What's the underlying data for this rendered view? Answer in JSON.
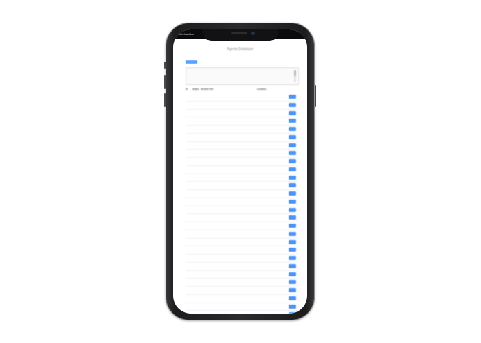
{
  "status_bar": {
    "left": "Job Machine",
    "right": ""
  },
  "page": {
    "title": "Agents Database",
    "add_button": ""
  },
  "search": {
    "lines": [
      "",
      "",
      "",
      ""
    ]
  },
  "table": {
    "headers": [
      "ID",
      "Status",
      "Number",
      "Title",
      "",
      "Location"
    ],
    "rows": [
      {
        "id": "",
        "status": "",
        "num": "",
        "name": "",
        "loc": ""
      },
      {
        "id": "",
        "status": "",
        "num": "",
        "name": "",
        "loc": ""
      },
      {
        "id": "",
        "status": "",
        "num": "",
        "name": "",
        "loc": ""
      },
      {
        "id": "",
        "status": "",
        "num": "",
        "name": "",
        "loc": ""
      },
      {
        "id": "",
        "status": "",
        "num": "",
        "name": "",
        "loc": ""
      },
      {
        "id": "",
        "status": "",
        "num": "",
        "name": "",
        "loc": ""
      },
      {
        "id": "",
        "status": "",
        "num": "",
        "name": "",
        "loc": ""
      },
      {
        "id": "",
        "status": "",
        "num": "",
        "name": "",
        "loc": ""
      },
      {
        "id": "",
        "status": "",
        "num": "",
        "name": "",
        "loc": ""
      },
      {
        "id": "",
        "status": "",
        "num": "",
        "name": "",
        "loc": ""
      },
      {
        "id": "",
        "status": "",
        "num": "",
        "name": "",
        "loc": ""
      },
      {
        "id": "",
        "status": "",
        "num": "",
        "name": "",
        "loc": ""
      },
      {
        "id": "",
        "status": "",
        "num": "",
        "name": "",
        "loc": ""
      },
      {
        "id": "",
        "status": "",
        "num": "",
        "name": "",
        "loc": ""
      },
      {
        "id": "",
        "status": "",
        "num": "",
        "name": "",
        "loc": ""
      },
      {
        "id": "",
        "status": "",
        "num": "",
        "name": "",
        "loc": ""
      },
      {
        "id": "",
        "status": "",
        "num": "",
        "name": "",
        "loc": ""
      },
      {
        "id": "",
        "status": "",
        "num": "",
        "name": "",
        "loc": ""
      },
      {
        "id": "",
        "status": "",
        "num": "",
        "name": "",
        "loc": ""
      },
      {
        "id": "",
        "status": "",
        "num": "",
        "name": "",
        "loc": ""
      },
      {
        "id": "",
        "status": "",
        "num": "",
        "name": "",
        "loc": ""
      },
      {
        "id": "",
        "status": "",
        "num": "",
        "name": "",
        "loc": ""
      },
      {
        "id": "",
        "status": "",
        "num": "",
        "name": "",
        "loc": ""
      },
      {
        "id": "",
        "status": "",
        "num": "",
        "name": "",
        "loc": ""
      },
      {
        "id": "",
        "status": "",
        "num": "",
        "name": "",
        "loc": ""
      },
      {
        "id": "",
        "status": "",
        "num": "",
        "name": "",
        "loc": ""
      },
      {
        "id": "",
        "status": "",
        "num": "",
        "name": "",
        "loc": ""
      },
      {
        "id": "",
        "status": "",
        "num": "",
        "name": "",
        "loc": ""
      },
      {
        "id": "",
        "status": "",
        "num": "",
        "name": "",
        "loc": ""
      },
      {
        "id": "",
        "status": "",
        "num": "",
        "name": "",
        "loc": ""
      }
    ]
  },
  "colors": {
    "accent": "#4d95f5",
    "frame": "#1c1c1e",
    "screen_bg": "#ffffff"
  },
  "icons": {
    "notch": "phone-notch-icon",
    "camera": "front-camera-icon"
  }
}
